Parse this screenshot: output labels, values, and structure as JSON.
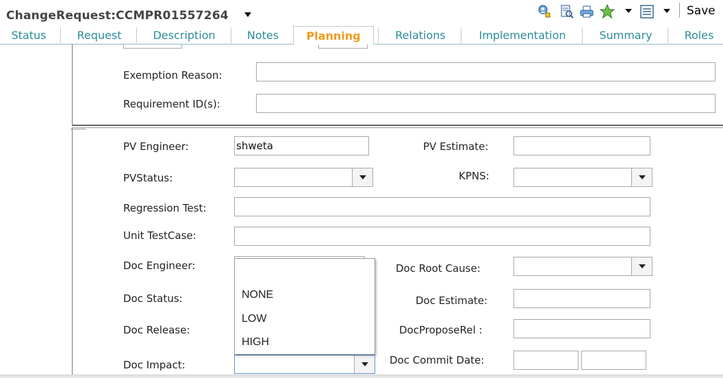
{
  "header": {
    "title": "ChangeRequest:CCMPR01557264",
    "save_label": "Save",
    "icons": [
      "user-query-icon",
      "document-search-icon",
      "print-icon",
      "favorite-star-icon",
      "list-icon"
    ]
  },
  "tabs": [
    {
      "label": "Status"
    },
    {
      "label": "Request"
    },
    {
      "label": "Description"
    },
    {
      "label": "Notes"
    },
    {
      "label": "Planning",
      "active": true
    },
    {
      "label": "Relations"
    },
    {
      "label": "Implementation"
    },
    {
      "label": "Summary"
    },
    {
      "label": "Roles"
    }
  ],
  "colors": {
    "tab_text": "#2b8c9c",
    "active_tab": "#f39a1d"
  },
  "form_top": {
    "exemption_reason": {
      "label": "Exemption Reason:",
      "value": ""
    },
    "requirement_ids": {
      "label": "Requirement ID(s):",
      "value": ""
    }
  },
  "form_bottom": {
    "pv_engineer": {
      "label": "PV Engineer:",
      "value": "shweta"
    },
    "pv_estimate": {
      "label": "PV Estimate:",
      "value": ""
    },
    "pv_status": {
      "label": "PVStatus:",
      "value": ""
    },
    "kpns": {
      "label": "KPNS:",
      "value": ""
    },
    "regression_test": {
      "label": "Regression Test:",
      "value": ""
    },
    "unit_testcase": {
      "label": "Unit TestCase:",
      "value": ""
    },
    "doc_engineer": {
      "label": "Doc Engineer:",
      "value": ""
    },
    "doc_root_cause": {
      "label": "Doc Root Cause:",
      "value": ""
    },
    "doc_status": {
      "label": "Doc Status:",
      "value": ""
    },
    "doc_estimate": {
      "label": "Doc Estimate:",
      "value": ""
    },
    "doc_release": {
      "label": "Doc Release:",
      "value": ""
    },
    "doc_propose_rel": {
      "label": "DocProposeRel :",
      "value": ""
    },
    "doc_impact": {
      "label": "Doc Impact:",
      "value": ""
    },
    "doc_commit_date": {
      "label": "Doc Commit Date:",
      "value": ""
    }
  },
  "doc_impact_options": [
    "",
    "NONE",
    "LOW",
    "HIGH"
  ]
}
